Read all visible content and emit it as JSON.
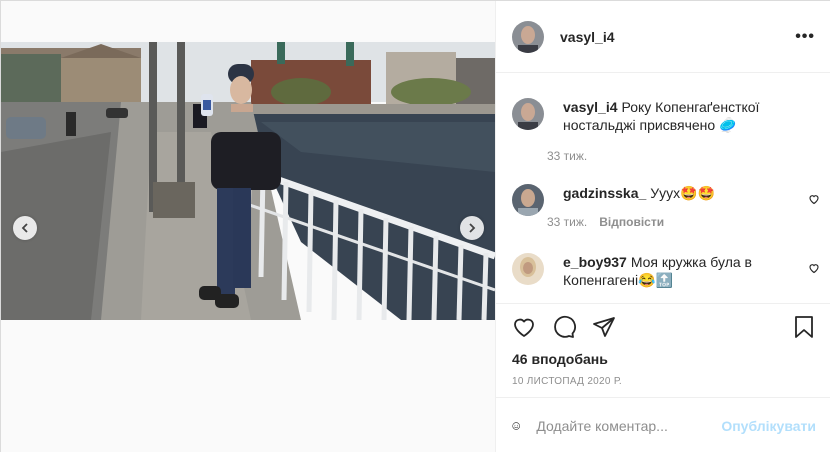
{
  "post": {
    "author": "vasyl_i4",
    "more_icon": "more-horizontal-icon",
    "likes": "46 вподобань",
    "date": "10 ЛИСТОПАД 2020 Р."
  },
  "caption": {
    "username": "vasyl_i4",
    "text": "Року Копенгаґенсткої ностальджі присвячено",
    "emoji": "🥏",
    "time": "33 тиж."
  },
  "comments": [
    {
      "username": "gadzinsska_",
      "text": "Ууух🤩🤩",
      "time": "33 тиж.",
      "reply_label": "Відповісти"
    },
    {
      "username": "e_boy937",
      "text": "Моя кружка була в Копенгагені😂🔝"
    }
  ],
  "comment_box": {
    "placeholder": "Додайте коментар...",
    "post_label": "Опублікувати"
  },
  "colors": {
    "post_button": "#b2dffc",
    "muted": "#8e8e8e",
    "text": "#262626"
  }
}
